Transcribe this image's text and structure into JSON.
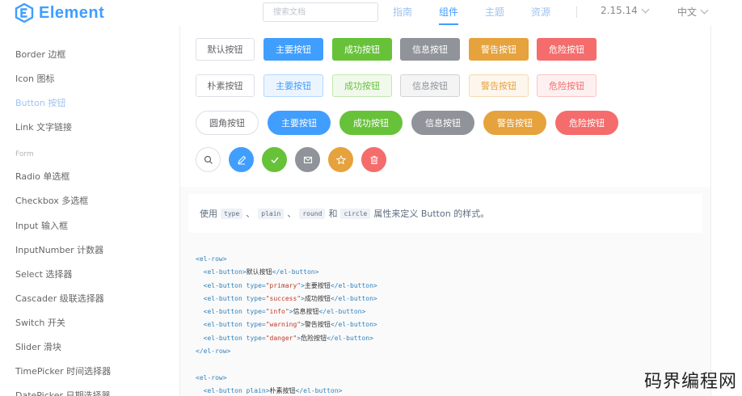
{
  "header": {
    "logo_text": "Element",
    "search_placeholder": "搜索文档",
    "nav": [
      "指南",
      "组件",
      "主题",
      "资源"
    ],
    "version": "2.15.14",
    "lang": "中文"
  },
  "sidebar": {
    "items_top": [
      "Border 边框",
      "Icon 图标",
      "Button 按钮",
      "Link 文字链接"
    ],
    "group": "Form",
    "items_form": [
      "Radio 单选框",
      "Checkbox 多选框",
      "Input 输入框",
      "InputNumber 计数器",
      "Select 选择器",
      "Cascader 级联选择器",
      "Switch 开关",
      "Slider 滑块",
      "TimePicker 时间选择器",
      "DatePicker 日期选择器"
    ]
  },
  "buttons": {
    "labels": [
      "默认按钮",
      "主要按钮",
      "成功按钮",
      "信息按钮",
      "警告按钮",
      "危险按钮"
    ],
    "plain_first": "朴素按钮",
    "round_first": "圆角按钮",
    "circle_icons": [
      "search-icon",
      "edit-icon",
      "check-icon",
      "message-icon",
      "star-icon",
      "delete-icon"
    ]
  },
  "description": {
    "prefix": "使用",
    "kw1": "type",
    "sep1": "、",
    "kw2": "plain",
    "sep2": "、",
    "kw3": "round",
    "and": "和",
    "kw4": "circle",
    "suffix": "属性来定义 Button 的样式。"
  },
  "code": {
    "l1": "<el-row>",
    "l2": "  <el-button>默认按钮</el-button>",
    "l3": "  <el-button type=\"primary\">主要按钮</el-button>",
    "l4": "  <el-button type=\"success\">成功按钮</el-button>",
    "l5": "  <el-button type=\"info\">信息按钮</el-button>",
    "l6": "  <el-button type=\"warning\">警告按钮</el-button>",
    "l7": "  <el-button type=\"danger\">危险按钮</el-button>",
    "l8": "</el-row>",
    "l9": "",
    "l10": "<el-row>",
    "l11": "  <el-button plain>朴素按钮</el-button>"
  },
  "watermark": "码界编程网",
  "colors": {
    "primary": "#409EFF",
    "success": "#67C23A",
    "info": "#909399",
    "warning": "#E6A23C",
    "danger": "#F56C6C"
  }
}
